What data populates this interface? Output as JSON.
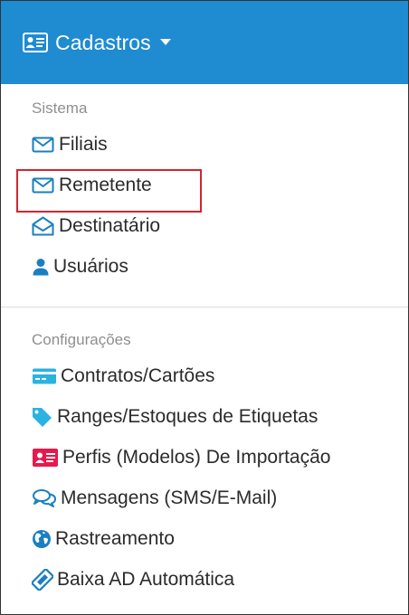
{
  "header": {
    "title": "Cadastros",
    "background": "#1f8bd1",
    "icon": "address-card-icon"
  },
  "sections": [
    {
      "label": "Sistema",
      "items": [
        {
          "label": "Filiais",
          "icon": "envelope-icon"
        },
        {
          "label": "Remetente",
          "icon": "envelope-icon"
        },
        {
          "label": "Destinatário",
          "icon": "envelope-open-icon"
        },
        {
          "label": "Usuários",
          "icon": "user-icon"
        }
      ]
    },
    {
      "label": "Configurações",
      "items": [
        {
          "label": "Contratos/Cartões",
          "icon": "credit-card-icon"
        },
        {
          "label": "Ranges/Estoques de Etiquetas",
          "icon": "tag-icon"
        },
        {
          "label": "Perfis (Modelos) De Importação",
          "icon": "id-card-icon"
        },
        {
          "label": "Mensagens (SMS/E-Mail)",
          "icon": "comments-icon"
        },
        {
          "label": "Rastreamento",
          "icon": "globe-icon"
        },
        {
          "label": "Baixa AD Automática",
          "icon": "ticket-icon"
        }
      ]
    }
  ],
  "colors": {
    "accent": "#1f8bd1",
    "icon_blue": "#1a7fc1",
    "id_card_red": "#e5194d",
    "highlight_border": "#d4252f",
    "section_label": "#8f8f8f"
  }
}
